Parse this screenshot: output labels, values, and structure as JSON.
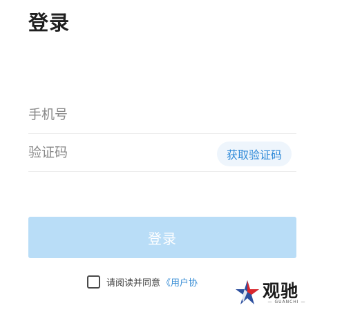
{
  "header": {
    "title": "登录"
  },
  "form": {
    "phone_placeholder": "手机号",
    "code_placeholder": "验证码",
    "get_code_label": "获取验证码",
    "submit_label": "登录"
  },
  "agreement": {
    "checked": false,
    "text": "请阅读并同意",
    "link_text": "《用户协"
  },
  "watermark": {
    "name": "观驰",
    "sub": "— GUANCHI —"
  },
  "colors": {
    "accent": "#2f8ad8",
    "button_bg": "#b9ddf7",
    "code_button_bg": "#eef5fc",
    "star_blue": "#2c4f9e",
    "star_red": "#d9262c"
  }
}
